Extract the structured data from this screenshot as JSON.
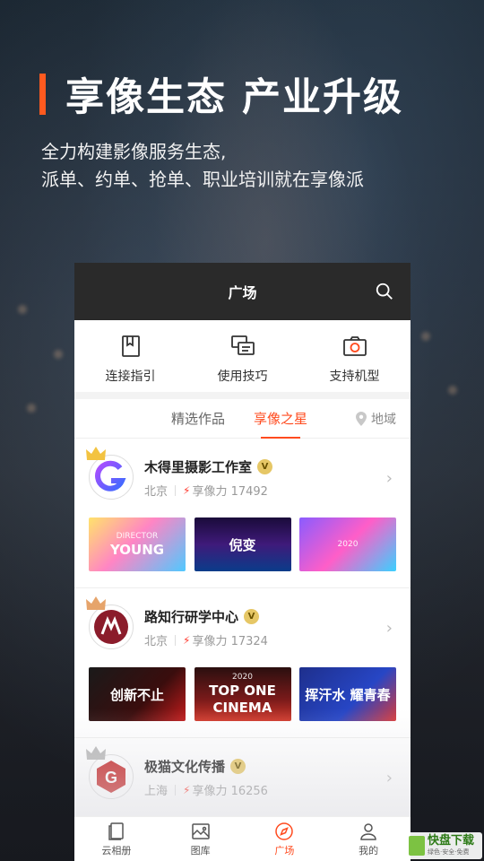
{
  "hero": {
    "title": "享像生态 产业升级",
    "subtitle_line1": "全力构建影像服务生态,",
    "subtitle_line2": "派单、约单、抢单、职业培训就在享像派",
    "accent_color": "#ff5a1f"
  },
  "app": {
    "header_title": "广场",
    "quick_links": [
      {
        "label": "连接指引",
        "icon": "book-icon"
      },
      {
        "label": "使用技巧",
        "icon": "chat-icon"
      },
      {
        "label": "支持机型",
        "icon": "camera-icon"
      }
    ],
    "tabs": [
      "精选作品",
      "享像之星"
    ],
    "active_tab": "享像之星",
    "region_label": "地域",
    "studios": [
      {
        "name": "木得里摄影工作室",
        "city": "北京",
        "power_label": "享像力 17492",
        "thumbs": [
          {
            "top": "DIRECTOR",
            "main": "YOUNG"
          },
          {
            "top": "",
            "main": "倪变"
          },
          {
            "top": "",
            "main": "2020"
          }
        ]
      },
      {
        "name": "路知行研学中心",
        "city": "北京",
        "power_label": "享像力 17324",
        "thumbs": [
          {
            "top": "",
            "main": "创新不止"
          },
          {
            "top": "2020",
            "main": "TOP ONE CINEMA"
          },
          {
            "top": "",
            "main": "挥汗水 耀青春"
          }
        ]
      },
      {
        "name": "极猫文化传播",
        "city": "上海",
        "power_label": "享像力 16256"
      }
    ],
    "tabbar": [
      {
        "label": "云相册",
        "icon": "album-icon"
      },
      {
        "label": "图库",
        "icon": "gallery-icon"
      },
      {
        "label": "广场",
        "icon": "compass-icon"
      },
      {
        "label": "我的",
        "icon": "person-icon"
      }
    ],
    "active_tabbar": "广场",
    "brand_color": "#ff4b1f"
  },
  "watermark": {
    "title": "快盘下载",
    "tagline": "绿色·安全·免费"
  }
}
